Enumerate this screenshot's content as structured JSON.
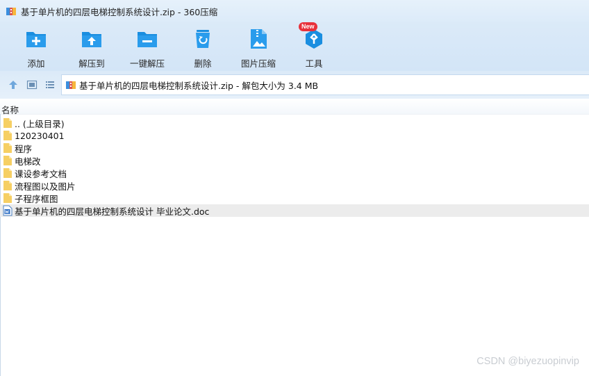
{
  "window": {
    "title": "基于单片机的四层电梯控制系统设计.zip - 360压缩"
  },
  "toolbar": {
    "items": [
      {
        "label": "添加",
        "icon": "add-folder-icon"
      },
      {
        "label": "解压到",
        "icon": "extract-to-icon"
      },
      {
        "label": "一键解压",
        "icon": "one-click-extract-icon"
      },
      {
        "label": "删除",
        "icon": "recycle-bin-icon"
      },
      {
        "label": "图片压缩",
        "icon": "image-compress-icon"
      },
      {
        "label": "工具",
        "icon": "tools-icon",
        "badge": "New"
      }
    ]
  },
  "address": {
    "path": "基于单片机的四层电梯控制系统设计.zip - 解包大小为 3.4 MB"
  },
  "list": {
    "column_name": "名称",
    "files": [
      {
        "name": ".. (上级目录)",
        "type": "folder"
      },
      {
        "name": "120230401",
        "type": "folder"
      },
      {
        "name": "程序",
        "type": "folder"
      },
      {
        "name": "电梯改",
        "type": "folder"
      },
      {
        "name": "课设参考文档",
        "type": "folder"
      },
      {
        "name": "流程图以及图片",
        "type": "folder"
      },
      {
        "name": "子程序框图",
        "type": "folder"
      },
      {
        "name": "基于单片机的四层电梯控制系统设计 毕业论文.doc",
        "type": "doc"
      }
    ]
  },
  "watermark": "CSDN @biyezuopinvip",
  "colors": {
    "accent_blue": "#1a8ee0",
    "folder": "#f6cf63",
    "badge_red": "#e8313b"
  }
}
